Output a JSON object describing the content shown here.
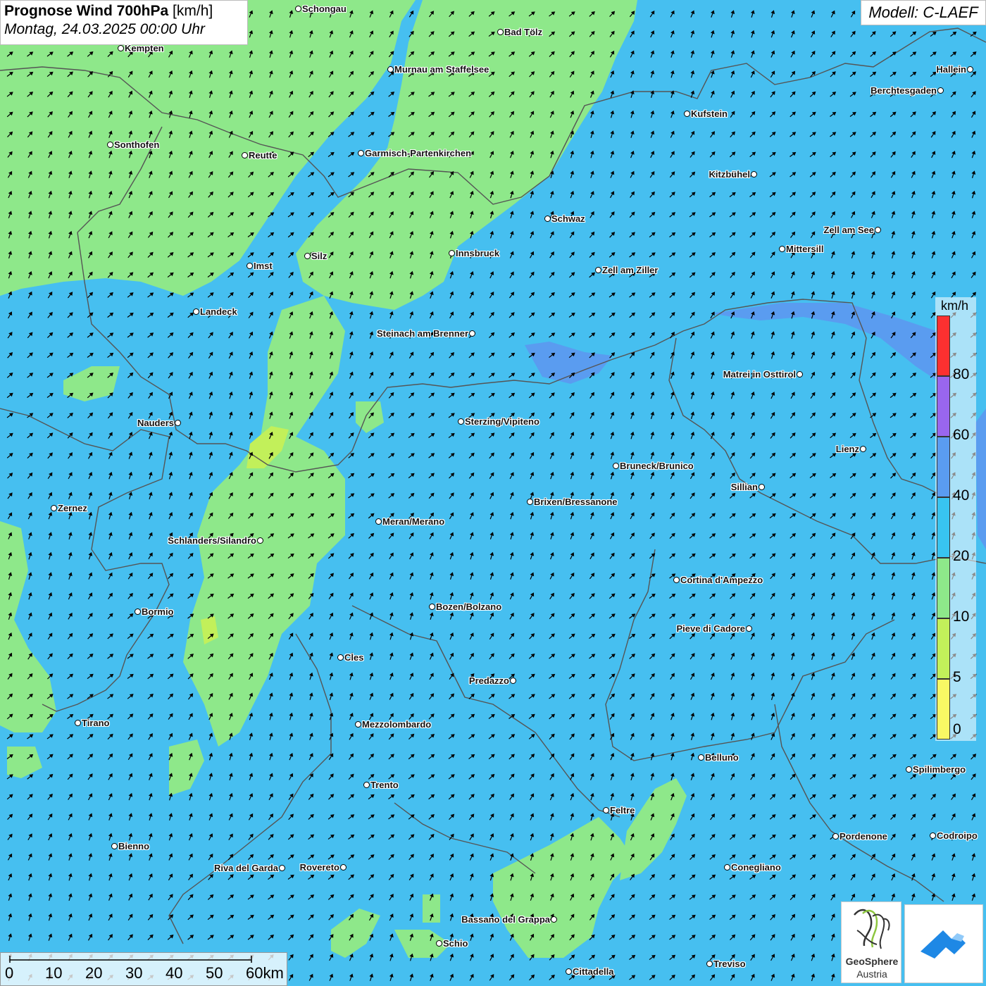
{
  "header": {
    "title_bold": "Prognose Wind 700hPa",
    "title_unit": "[km/h]",
    "subtitle": "Montag, 24.03.2025 00:00 Uhr",
    "model": "Modell: C-LAEF"
  },
  "legend": {
    "unit": "km/h",
    "levels": [
      {
        "label": "80",
        "color": "#fc3030"
      },
      {
        "label": "60",
        "color": "#9966ee"
      },
      {
        "label": "40",
        "color": "#5a9cf0"
      },
      {
        "label": "20",
        "color": "#38c4f0"
      },
      {
        "label": "10",
        "color": "#8ee88a"
      },
      {
        "label": "5",
        "color": "#c2f05a"
      },
      {
        "label": "0",
        "color": "#f8f864"
      }
    ]
  },
  "scalebar": {
    "labels": [
      "0",
      "10",
      "20",
      "30",
      "40",
      "50",
      "60km"
    ]
  },
  "cities": [
    {
      "name": "Schongau"
    },
    {
      "name": "Bad Tölz"
    },
    {
      "name": "Kempten"
    },
    {
      "name": "Murnau am Staffelsee"
    },
    {
      "name": "Hallein"
    },
    {
      "name": "Berchtesgaden"
    },
    {
      "name": "Kufstein"
    },
    {
      "name": "Sonthofen"
    },
    {
      "name": "Reutte"
    },
    {
      "name": "Garmisch-Partenkirchen"
    },
    {
      "name": "Kitzbühel"
    },
    {
      "name": "Schwaz"
    },
    {
      "name": "Zell am See"
    },
    {
      "name": "Innsbruck"
    },
    {
      "name": "Mittersill"
    },
    {
      "name": "Imst"
    },
    {
      "name": "Silz"
    },
    {
      "name": "Zell am Ziller"
    },
    {
      "name": "Landeck"
    },
    {
      "name": "Steinach am Brenner"
    },
    {
      "name": "Matrei in Osttirol"
    },
    {
      "name": "Nauders"
    },
    {
      "name": "Sterzing/Vipiteno"
    },
    {
      "name": "Lienz"
    },
    {
      "name": "Bruneck/Brunico"
    },
    {
      "name": "Sillian"
    },
    {
      "name": "Brixen/Bressanone"
    },
    {
      "name": "Zernez"
    },
    {
      "name": "Meran/Merano"
    },
    {
      "name": "Schlanders/Silandro"
    },
    {
      "name": "Cortina d'Ampezzo"
    },
    {
      "name": "Bozen/Bolzano"
    },
    {
      "name": "Bormio"
    },
    {
      "name": "Pieve di Cadore"
    },
    {
      "name": "Cles"
    },
    {
      "name": "Predazzo"
    },
    {
      "name": "Tirano"
    },
    {
      "name": "Mezzolombardo"
    },
    {
      "name": "Belluno"
    },
    {
      "name": "Spilimbergo"
    },
    {
      "name": "Trento"
    },
    {
      "name": "Feltre"
    },
    {
      "name": "Pordenone"
    },
    {
      "name": "Codroipo"
    },
    {
      "name": "Bienno"
    },
    {
      "name": "Riva del Garda"
    },
    {
      "name": "Rovereto"
    },
    {
      "name": "Conegliano"
    },
    {
      "name": "Bassano del Grappa"
    },
    {
      "name": "Schio"
    },
    {
      "name": "Treviso"
    },
    {
      "name": "Cittadella"
    }
  ],
  "logo": {
    "name_line1": "GeoSphere",
    "name_line2": "Austria"
  },
  "colors": {
    "low_wind_green": "#8ee88a",
    "base_blue": "#46bff0",
    "high_wind_blue": "#5a9cf0",
    "arrow": "#000000",
    "border": "#555555",
    "app_logo": "#1e88e5"
  }
}
